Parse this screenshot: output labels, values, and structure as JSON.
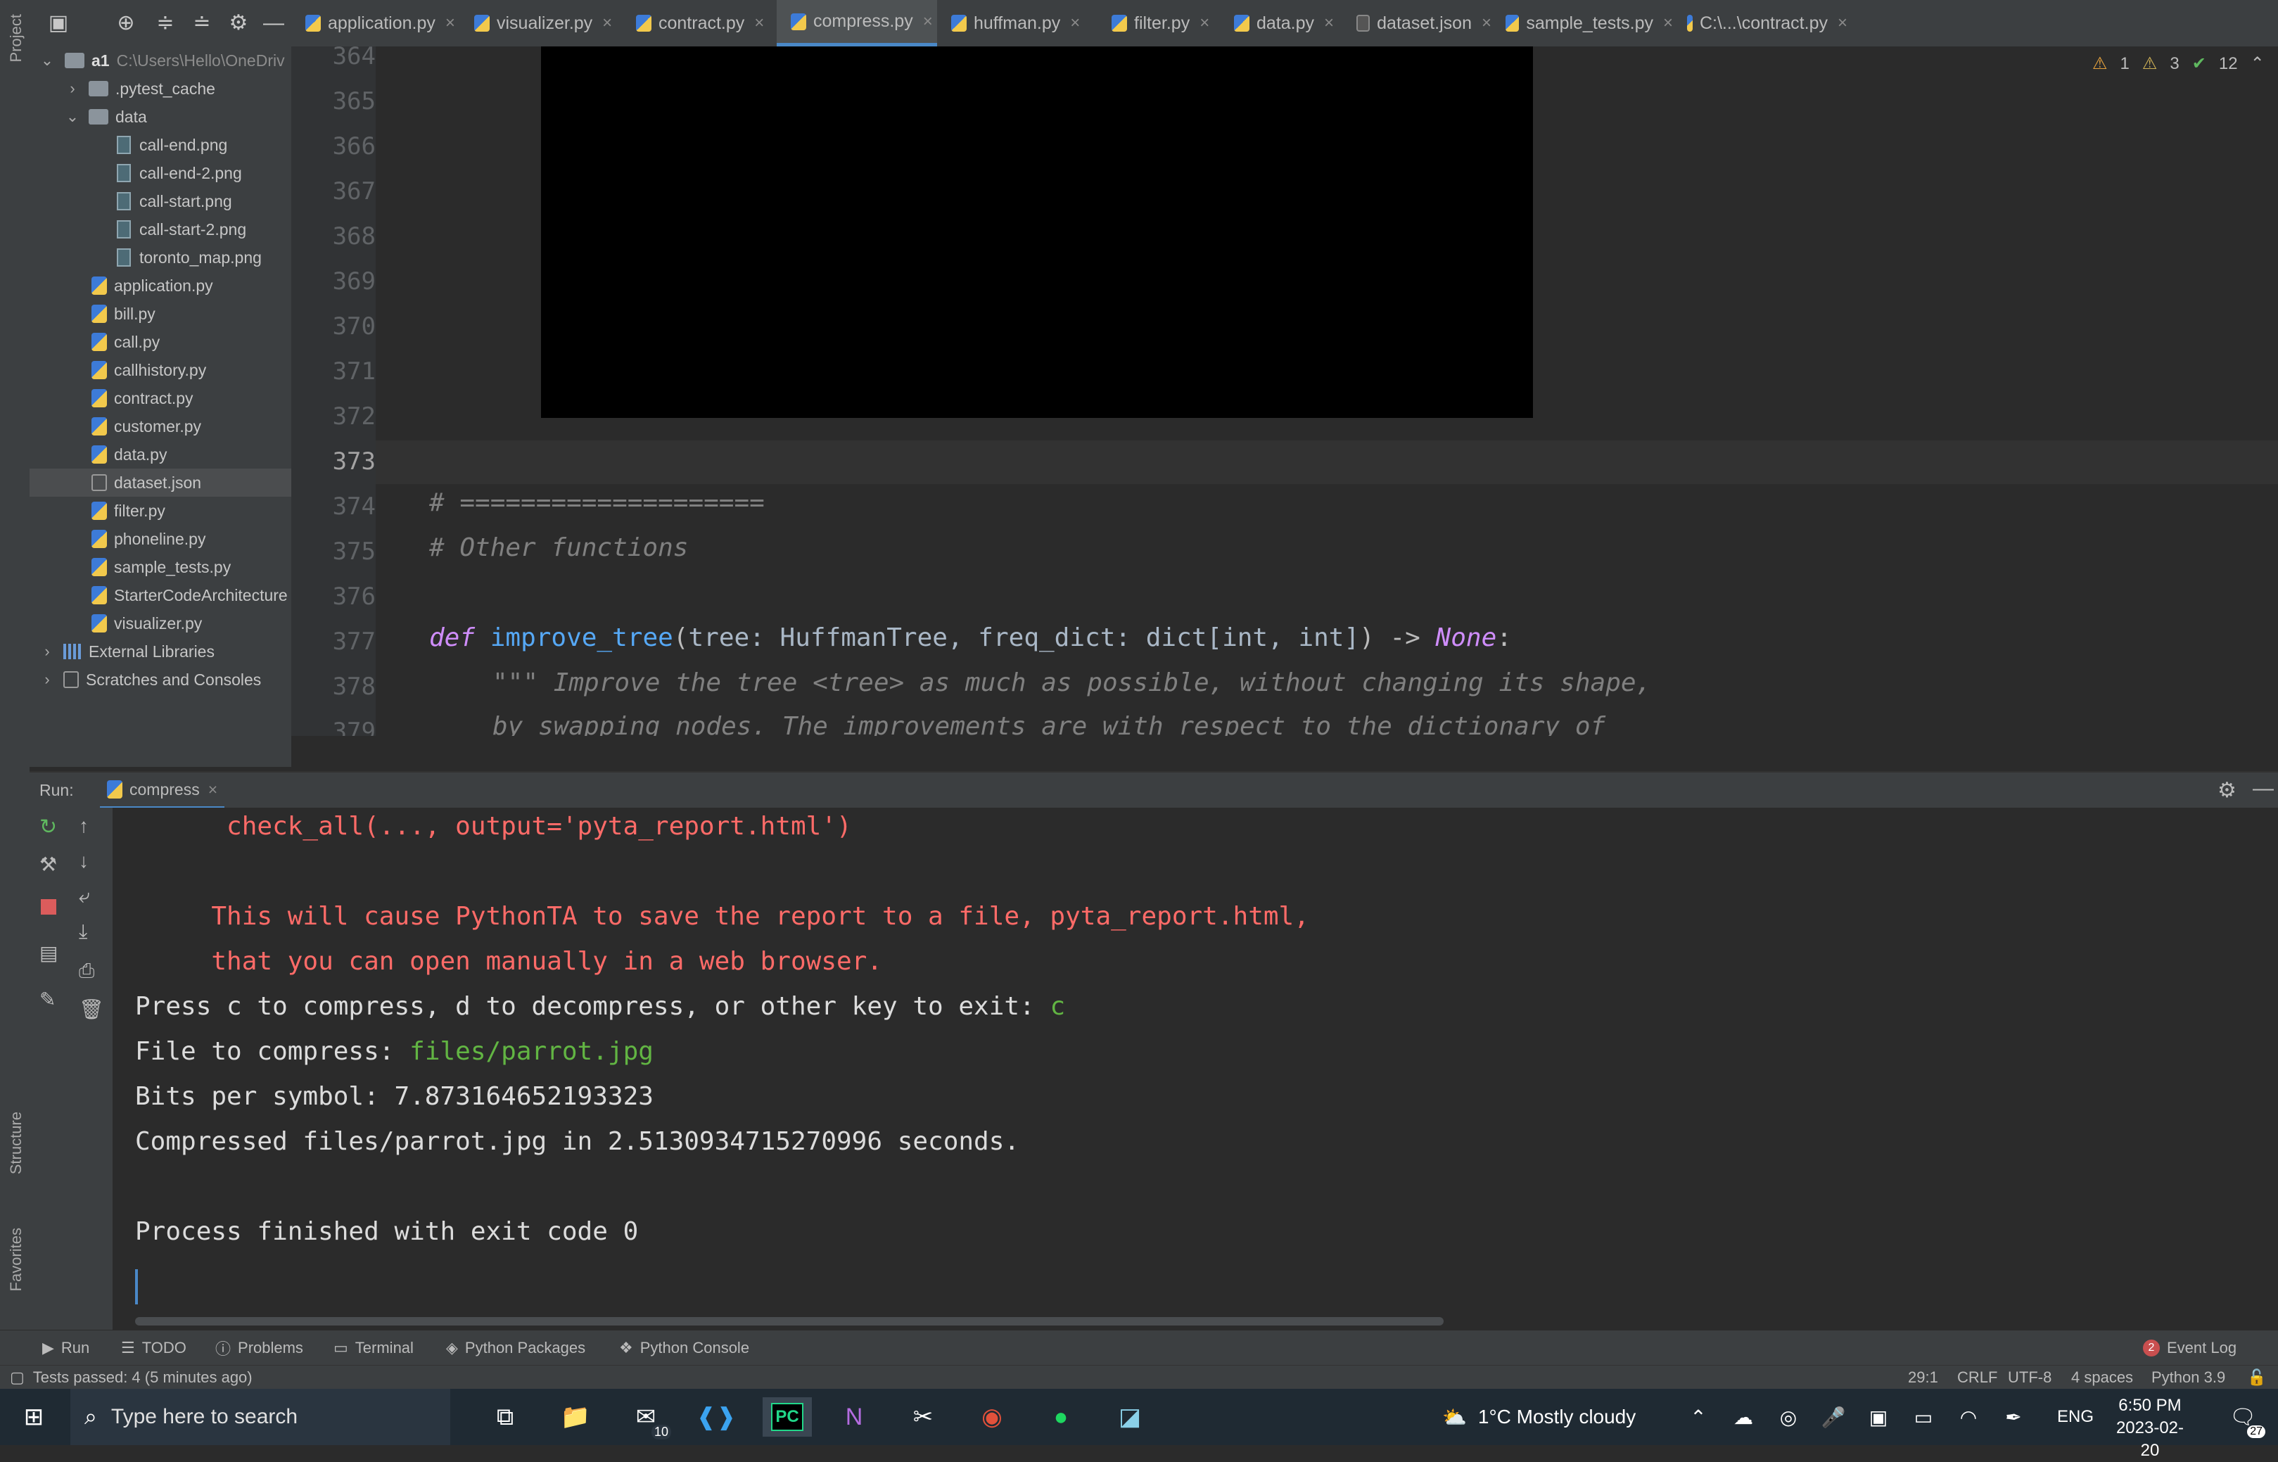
{
  "left_stripe": {
    "project": "Project",
    "structure": "Structure",
    "favorites": "Favorites"
  },
  "tabs": [
    {
      "label": "application.py",
      "type": "py"
    },
    {
      "label": "visualizer.py",
      "type": "py"
    },
    {
      "label": "contract.py",
      "type": "py"
    },
    {
      "label": "compress.py",
      "type": "py",
      "active": true
    },
    {
      "label": "huffman.py",
      "type": "py"
    },
    {
      "label": "filter.py",
      "type": "py"
    },
    {
      "label": "data.py",
      "type": "py"
    },
    {
      "label": "dataset.json",
      "type": "json"
    },
    {
      "label": "sample_tests.py",
      "type": "py"
    },
    {
      "label": "C:\\...\\contract.py",
      "type": "py"
    }
  ],
  "tree": {
    "root": "a1",
    "root_path": "C:\\Users\\Hello\\OneDriv",
    "items": [
      {
        "label": ".pytest_cache",
        "kind": "folder",
        "level": 1,
        "arrow": "›"
      },
      {
        "label": "data",
        "kind": "folder",
        "level": 1,
        "arrow": "⌄"
      },
      {
        "label": "call-end.png",
        "kind": "png",
        "level": 2
      },
      {
        "label": "call-end-2.png",
        "kind": "png",
        "level": 2
      },
      {
        "label": "call-start.png",
        "kind": "png",
        "level": 2
      },
      {
        "label": "call-start-2.png",
        "kind": "png",
        "level": 2
      },
      {
        "label": "toronto_map.png",
        "kind": "png",
        "level": 2
      },
      {
        "label": "application.py",
        "kind": "py",
        "level": 1
      },
      {
        "label": "bill.py",
        "kind": "py",
        "level": 1
      },
      {
        "label": "call.py",
        "kind": "py",
        "level": 1
      },
      {
        "label": "callhistory.py",
        "kind": "py",
        "level": 1
      },
      {
        "label": "contract.py",
        "kind": "py",
        "level": 1
      },
      {
        "label": "customer.py",
        "kind": "py",
        "level": 1
      },
      {
        "label": "data.py",
        "kind": "py",
        "level": 1
      },
      {
        "label": "dataset.json",
        "kind": "json",
        "level": 1,
        "selected": true
      },
      {
        "label": "filter.py",
        "kind": "py",
        "level": 1
      },
      {
        "label": "phoneline.py",
        "kind": "py",
        "level": 1
      },
      {
        "label": "sample_tests.py",
        "kind": "py",
        "level": 1
      },
      {
        "label": "StarterCodeArchitecture",
        "kind": "py",
        "level": 1
      },
      {
        "label": "visualizer.py",
        "kind": "py",
        "level": 1
      },
      {
        "label": "External Libraries",
        "kind": "lib",
        "level": 0,
        "arrow": "›"
      },
      {
        "label": "Scratches and Consoles",
        "kind": "scratch",
        "level": 0,
        "arrow": "›"
      }
    ]
  },
  "editor": {
    "inspections": {
      "warn1": "1",
      "warn2": "3",
      "ok": "12"
    },
    "line_numbers": [
      "364",
      "365",
      "366",
      "367",
      "368",
      "369",
      "370",
      "371",
      "372",
      "373",
      "374",
      "375",
      "376",
      "377",
      "378",
      "379"
    ],
    "code_374": "# ====================",
    "code_375": "# Other functions",
    "code_377_def": "def",
    "code_377_name": "improve_tree",
    "code_377_open": "(",
    "code_377_params": "tree: HuffmanTree, freq_dict: dict[int, int]",
    "code_377_arrow": ") ->",
    "code_377_none": "None",
    "code_377_colon": ":",
    "code_378": "\"\"\" Improve the tree <tree> as much as possible, without changing its shape,",
    "code_379": "by swapping nodes. The improvements are with respect to the dictionary of"
  },
  "run": {
    "title": "Run:",
    "tab": "compress",
    "lines": [
      {
        "text": "      check_all(..., output='pyta_report.html')",
        "style": "err"
      },
      {
        "text": "",
        "style": "plain"
      },
      {
        "text": "     This will cause PythonTA to save the report to a file, pyta_report.html,",
        "style": "err"
      },
      {
        "text": "     that you can open manually in a web browser.",
        "style": "err"
      },
      {
        "text": "Press c to compress, d to decompress, or other key to exit: ",
        "style": "plain",
        "input": "c"
      },
      {
        "text": "File to compress: ",
        "style": "plain",
        "input": "files/parrot.jpg"
      },
      {
        "text": "Bits per symbol: 7.873164652193323",
        "style": "plain"
      },
      {
        "text": "Compressed files/parrot.jpg in 2.5130934715270996 seconds.",
        "style": "plain"
      },
      {
        "text": "",
        "style": "plain"
      },
      {
        "text": "Process finished with exit code 0",
        "style": "plain"
      }
    ]
  },
  "tool_tabs": {
    "run": "Run",
    "todo": "TODO",
    "problems": "Problems",
    "terminal": "Terminal",
    "packages": "Python Packages",
    "console": "Python Console",
    "event_log": "Event Log",
    "event_count": "2"
  },
  "status": {
    "tests": "Tests passed: 4 (5 minutes ago)",
    "position": "29:1",
    "line_sep": "CRLF",
    "encoding": "UTF-8",
    "indent": "4 spaces",
    "interpreter": "Python 3.9"
  },
  "taskbar": {
    "search_placeholder": "Type here to search",
    "mail_badge": "10",
    "weather": "1°C  Mostly cloudy",
    "lang": "ENG",
    "time": "6:50 PM",
    "date": "2023-02-20",
    "notif": "27"
  }
}
